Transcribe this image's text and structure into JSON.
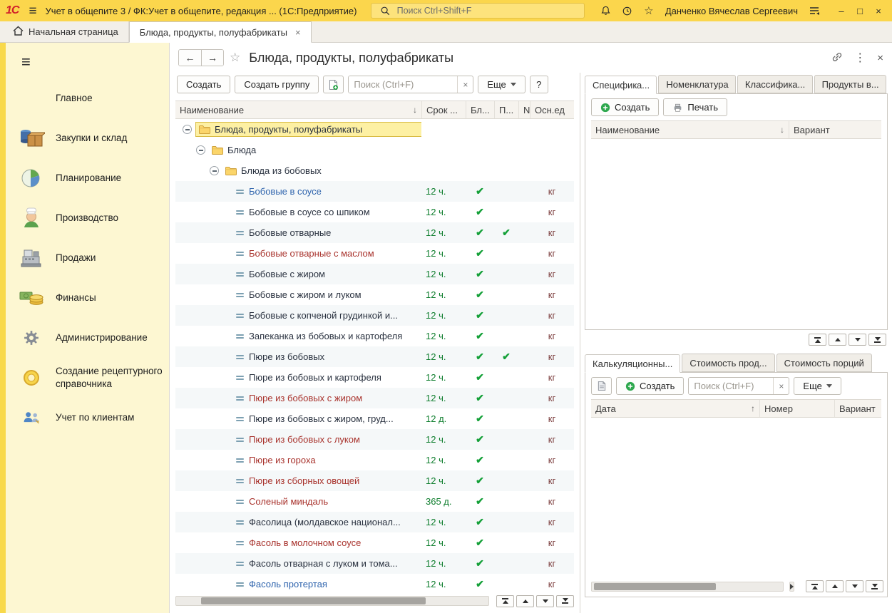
{
  "theme": {
    "brand_yellow": "#FBD64C",
    "sidebar_yellow": "#FDF7D2",
    "selection_yellow": "#FDF0A3",
    "check_green": "#14A038",
    "term_green": "#0F7E2E",
    "item_red": "#A8322C",
    "item_blue": "#2F64AD",
    "unit_maroon": "#7F4242"
  },
  "titlebar": {
    "logo": "1С",
    "app_title": "Учет в общепите 3 / ФК:Учет в общепите, редакция ...  (1С:Предприятие)",
    "search_placeholder": "Поиск Ctrl+Shift+F",
    "user": "Данченко Вячеслав Сергеевич",
    "minimize": "–",
    "maximize": "□",
    "close": "×"
  },
  "tabbar": {
    "home_tab": "Начальная страница",
    "active_tab": "Блюда, продукты, полуфабрикаты",
    "tab_close": "×"
  },
  "sidebar": {
    "items": [
      {
        "label": "Главное"
      },
      {
        "label": "Закупки и склад"
      },
      {
        "label": "Планирование"
      },
      {
        "label": "Производство"
      },
      {
        "label": "Продажи"
      },
      {
        "label": "Финансы"
      },
      {
        "label": "Администрирование"
      },
      {
        "label": "Создание рецептурного справочника"
      },
      {
        "label": "Учет по клиентам"
      }
    ]
  },
  "form": {
    "title": "Блюда, продукты, полуфабрикаты",
    "back": "←",
    "forward": "→",
    "more_dots": "⋮",
    "close": "×"
  },
  "main": {
    "toolbar": {
      "create": "Создать",
      "create_group": "Создать группу",
      "search_placeholder": "Поиск (Ctrl+F)",
      "search_clear": "×",
      "more": "Еще",
      "help": "?"
    },
    "table": {
      "headers": {
        "name": "Наименование",
        "name_sort": "↓",
        "term": "Срок ...",
        "bl": "Бл...",
        "p": "П...",
        "n": "N",
        "unit": "Осн.ед"
      },
      "rows": [
        {
          "kind": "group",
          "level": 0,
          "name": "Блюда, продукты, полуфабрикаты",
          "selected": true
        },
        {
          "kind": "group",
          "level": 1,
          "name": "Блюда"
        },
        {
          "kind": "group",
          "level": 2,
          "name": "Блюда из бобовых"
        },
        {
          "kind": "item",
          "level": 3,
          "name": "Бобовые в соусе",
          "term": "12 ч.",
          "bl": true,
          "p": false,
          "unit": "кг",
          "color": "blue"
        },
        {
          "kind": "item",
          "level": 3,
          "name": "Бобовые в соусе со шпиком",
          "term": "12 ч.",
          "bl": true,
          "p": false,
          "unit": "кг",
          "color": "black"
        },
        {
          "kind": "item",
          "level": 3,
          "name": "Бобовые отварные",
          "term": "12 ч.",
          "bl": true,
          "p": true,
          "unit": "кг",
          "color": "black"
        },
        {
          "kind": "item",
          "level": 3,
          "name": "Бобовые отварные с маслом",
          "term": "12 ч.",
          "bl": true,
          "p": false,
          "unit": "кг",
          "color": "red"
        },
        {
          "kind": "item",
          "level": 3,
          "name": "Бобовые с жиром",
          "term": "12 ч.",
          "bl": true,
          "p": false,
          "unit": "кг",
          "color": "black"
        },
        {
          "kind": "item",
          "level": 3,
          "name": "Бобовые с жиром и луком",
          "term": "12 ч.",
          "bl": true,
          "p": false,
          "unit": "кг",
          "color": "black"
        },
        {
          "kind": "item",
          "level": 3,
          "name": "Бобовые с копченой грудинкой и...",
          "term": "12 ч.",
          "bl": true,
          "p": false,
          "unit": "кг",
          "color": "black"
        },
        {
          "kind": "item",
          "level": 3,
          "name": "Запеканка из бобовых и картофеля",
          "term": "12 ч.",
          "bl": true,
          "p": false,
          "unit": "кг",
          "color": "black"
        },
        {
          "kind": "item",
          "level": 3,
          "name": "Пюре из бобовых",
          "term": "12 ч.",
          "bl": true,
          "p": true,
          "unit": "кг",
          "color": "black"
        },
        {
          "kind": "item",
          "level": 3,
          "name": "Пюре из бобовых и картофеля",
          "term": "12 ч.",
          "bl": true,
          "p": false,
          "unit": "кг",
          "color": "black"
        },
        {
          "kind": "item",
          "level": 3,
          "name": "Пюре из бобовых с жиром",
          "term": "12 ч.",
          "bl": true,
          "p": false,
          "unit": "кг",
          "color": "red"
        },
        {
          "kind": "item",
          "level": 3,
          "name": "Пюре из бобовых с жиром, груд...",
          "term": "12 д.",
          "bl": true,
          "p": false,
          "unit": "кг",
          "color": "black"
        },
        {
          "kind": "item",
          "level": 3,
          "name": "Пюре из бобовых с луком",
          "term": "12 ч.",
          "bl": true,
          "p": false,
          "unit": "кг",
          "color": "red"
        },
        {
          "kind": "item",
          "level": 3,
          "name": "Пюре из гороха",
          "term": "12 ч.",
          "bl": true,
          "p": false,
          "unit": "кг",
          "color": "red"
        },
        {
          "kind": "item",
          "level": 3,
          "name": "Пюре из сборных овощей",
          "term": "12 ч.",
          "bl": true,
          "p": false,
          "unit": "кг",
          "color": "red"
        },
        {
          "kind": "item",
          "level": 3,
          "name": "Соленый миндаль",
          "term": "365 д.",
          "bl": true,
          "p": false,
          "unit": "кг",
          "color": "red"
        },
        {
          "kind": "item",
          "level": 3,
          "name": "Фасолица (молдавское национал...",
          "term": "12 ч.",
          "bl": true,
          "p": false,
          "unit": "кг",
          "color": "black"
        },
        {
          "kind": "item",
          "level": 3,
          "name": "Фасоль в молочном соусе",
          "term": "12 ч.",
          "bl": true,
          "p": false,
          "unit": "кг",
          "color": "red"
        },
        {
          "kind": "item",
          "level": 3,
          "name": "Фасоль отварная с луком и тома...",
          "term": "12 ч.",
          "bl": true,
          "p": false,
          "unit": "кг",
          "color": "black"
        },
        {
          "kind": "item",
          "level": 3,
          "name": "Фасоль протертая",
          "term": "12 ч.",
          "bl": true,
          "p": false,
          "unit": "кг",
          "color": "blue"
        }
      ]
    }
  },
  "spec_panel": {
    "tabs": [
      {
        "label": "Спецификa..."
      },
      {
        "label": "Номенклатура"
      },
      {
        "label": "Классификa..."
      },
      {
        "label": "Продукты в..."
      }
    ],
    "toolbar": {
      "create": "Создать",
      "print": "Печать"
    },
    "headers": {
      "name": "Наименование",
      "name_sort": "↓",
      "variant": "Вариант"
    }
  },
  "calc_panel": {
    "tabs": [
      {
        "label": "Калькуляционны..."
      },
      {
        "label": "Стоимость прод..."
      },
      {
        "label": "Стоимость порций"
      }
    ],
    "toolbar": {
      "create": "Создать",
      "search_placeholder": "Поиск (Ctrl+F)",
      "search_clear": "×",
      "more": "Еще"
    },
    "headers": {
      "date": "Дата",
      "date_sort": "↑",
      "number": "Номер",
      "variant": "Вариант"
    }
  }
}
